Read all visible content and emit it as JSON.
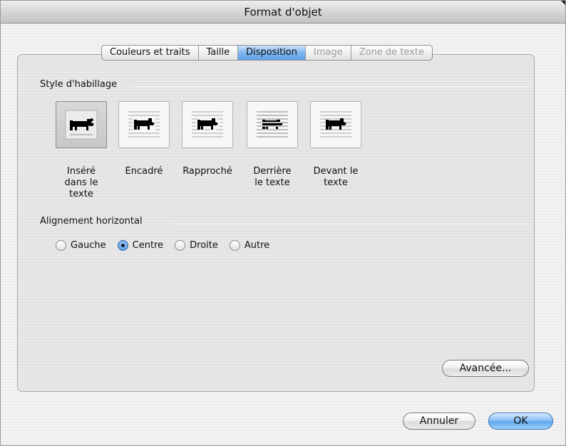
{
  "window": {
    "title": "Format d'objet"
  },
  "tabs": [
    {
      "label": "Couleurs et traits",
      "state": "normal"
    },
    {
      "label": "Taille",
      "state": "normal"
    },
    {
      "label": "Disposition",
      "state": "active"
    },
    {
      "label": "Image",
      "state": "disabled"
    },
    {
      "label": "Zone de texte",
      "state": "disabled"
    }
  ],
  "wrapping": {
    "section_label": "Style d'habillage",
    "styles": [
      {
        "label": "Inséré dans le texte",
        "lines": [
          "Inséré",
          "dans le",
          "texte"
        ],
        "icon": "inline-dog-icon",
        "selected": true
      },
      {
        "label": "Encadré",
        "lines": [
          "Encadré"
        ],
        "icon": "square-wrap-dog-icon",
        "selected": false
      },
      {
        "label": "Rapproché",
        "lines": [
          "Rapproché"
        ],
        "icon": "tight-wrap-dog-icon",
        "selected": false
      },
      {
        "label": "Derrière le texte",
        "lines": [
          "Derrière",
          "le texte"
        ],
        "icon": "behind-text-dog-icon",
        "selected": false
      },
      {
        "label": "Devant le texte",
        "lines": [
          "Devant le",
          "texte"
        ],
        "icon": "in-front-text-dog-icon",
        "selected": false
      }
    ]
  },
  "alignment": {
    "section_label": "Alignement horizontal",
    "options": [
      {
        "label": "Gauche",
        "checked": false
      },
      {
        "label": "Centre",
        "checked": true
      },
      {
        "label": "Droite",
        "checked": false
      },
      {
        "label": "Autre",
        "checked": false
      }
    ]
  },
  "buttons": {
    "advanced": "Avancée...",
    "cancel": "Annuler",
    "ok": "OK"
  },
  "colors": {
    "accent": "#5ea1e8",
    "default_button": "#6aaef0"
  }
}
